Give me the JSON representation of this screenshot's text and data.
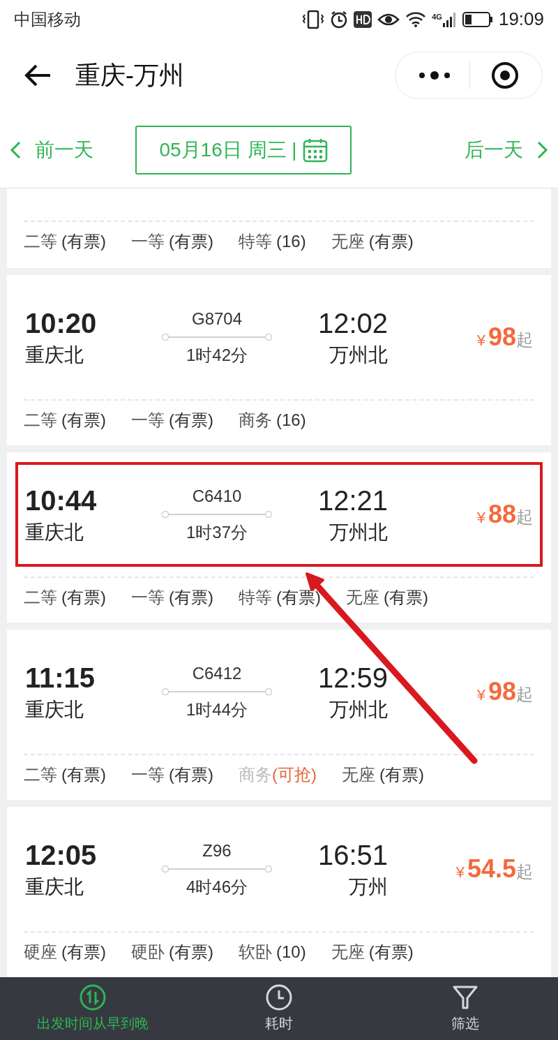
{
  "status_bar": {
    "carrier": "中国移动",
    "network": "4G",
    "time": "19:09"
  },
  "header": {
    "title": "重庆-万州"
  },
  "date_nav": {
    "prev": "前一天",
    "date": "05月16日 周三 |",
    "next": "后一天"
  },
  "trains": [
    {
      "kind": "partial",
      "seats": [
        {
          "class": "二等",
          "status": "(有票)",
          "grabbable": false
        },
        {
          "class": "一等",
          "status": "(有票)",
          "grabbable": false
        },
        {
          "class": "特等",
          "status": "(16)",
          "grabbable": false
        },
        {
          "class": "无座",
          "status": "(有票)",
          "grabbable": false
        }
      ]
    },
    {
      "kind": "full",
      "highlighted": false,
      "dep_time": "10:20",
      "dep_station": "重庆北",
      "train_no": "G8704",
      "duration": "1时42分",
      "arr_time": "12:02",
      "arr_station": "万州北",
      "currency": "¥",
      "price": "98",
      "price_suffix": "起",
      "seats": [
        {
          "class": "二等",
          "status": "(有票)",
          "grabbable": false
        },
        {
          "class": "一等",
          "status": "(有票)",
          "grabbable": false
        },
        {
          "class": "商务",
          "status": "(16)",
          "grabbable": false
        }
      ]
    },
    {
      "kind": "full",
      "highlighted": true,
      "dep_time": "10:44",
      "dep_station": "重庆北",
      "train_no": "C6410",
      "duration": "1时37分",
      "arr_time": "12:21",
      "arr_station": "万州北",
      "currency": "¥",
      "price": "88",
      "price_suffix": "起",
      "seats": [
        {
          "class": "二等",
          "status": "(有票)",
          "grabbable": false
        },
        {
          "class": "一等",
          "status": "(有票)",
          "grabbable": false
        },
        {
          "class": "特等",
          "status": "(有票)",
          "grabbable": false
        },
        {
          "class": "无座",
          "status": "(有票)",
          "grabbable": false
        }
      ]
    },
    {
      "kind": "full",
      "highlighted": false,
      "dep_time": "11:15",
      "dep_station": "重庆北",
      "train_no": "C6412",
      "duration": "1时44分",
      "arr_time": "12:59",
      "arr_station": "万州北",
      "currency": "¥",
      "price": "98",
      "price_suffix": "起",
      "seats": [
        {
          "class": "二等",
          "status": "(有票)",
          "grabbable": false
        },
        {
          "class": "一等",
          "status": "(有票)",
          "grabbable": false
        },
        {
          "class": "商务",
          "status": "(可抢)",
          "grabbable": true
        },
        {
          "class": "无座",
          "status": "(有票)",
          "grabbable": false
        }
      ]
    },
    {
      "kind": "full",
      "highlighted": false,
      "dep_time": "12:05",
      "dep_station": "重庆北",
      "train_no": "Z96",
      "duration": "4时46分",
      "arr_time": "16:51",
      "arr_station": "万州",
      "currency": "¥",
      "price": "54.5",
      "price_suffix": "起",
      "seats": [
        {
          "class": "硬座",
          "status": "(有票)",
          "grabbable": false
        },
        {
          "class": "硬卧",
          "status": "(有票)",
          "grabbable": false
        },
        {
          "class": "软卧",
          "status": "(10)",
          "grabbable": false
        },
        {
          "class": "无座",
          "status": "(有票)",
          "grabbable": false
        }
      ]
    }
  ],
  "bottom_tabs": [
    {
      "kind": "sort",
      "label": "出发时间从早到晚",
      "selected": true
    },
    {
      "kind": "duration",
      "label": "耗时",
      "selected": false
    },
    {
      "kind": "filter",
      "label": "筛选",
      "selected": false
    }
  ]
}
